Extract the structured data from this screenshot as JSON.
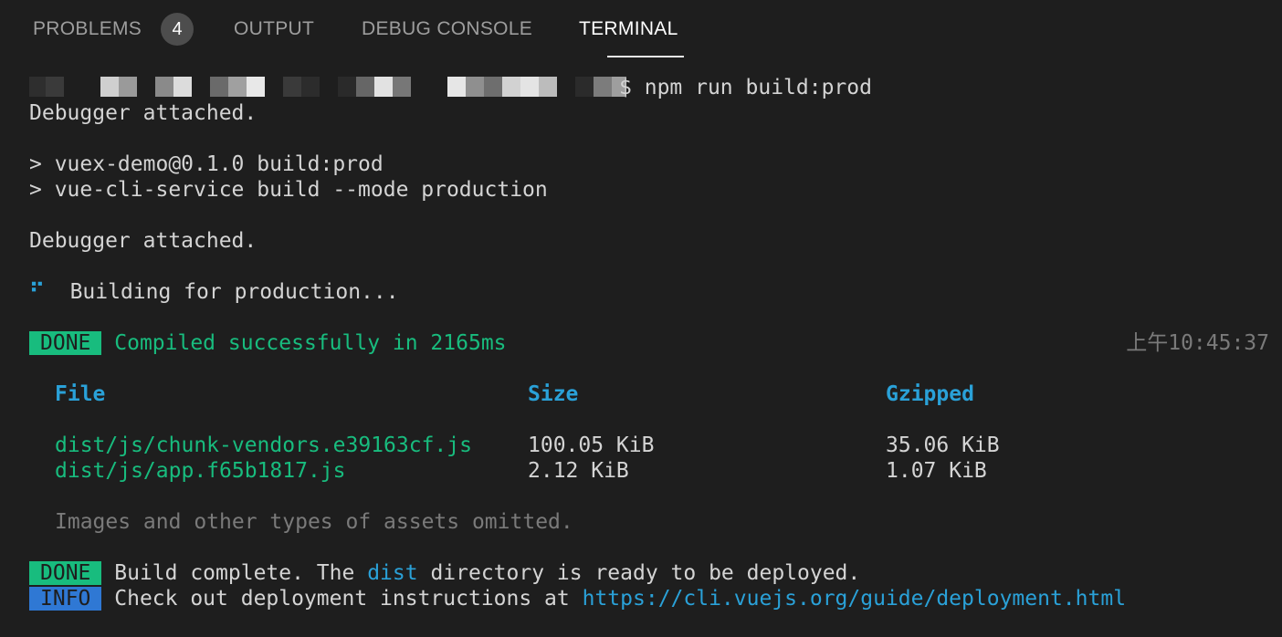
{
  "panel": {
    "tabs": [
      {
        "label": "PROBLEMS",
        "badge": "4"
      },
      {
        "label": "OUTPUT"
      },
      {
        "label": "DEBUG CONSOLE"
      },
      {
        "label": "TERMINAL",
        "active": true
      }
    ]
  },
  "terminal": {
    "prompt_symbol": "$",
    "command": "npm run build:prod",
    "debugger_1": "Debugger attached.",
    "script_1": "> vuex-demo@0.1.0 build:prod",
    "script_2": "> vue-cli-service build --mode production",
    "debugger_2": "Debugger attached.",
    "spinner": "⠋",
    "building": "Building for production...",
    "done_tag": "DONE",
    "compiled": "Compiled successfully in 2165ms",
    "timestamp": "上午10:45:37",
    "table": {
      "headers": [
        "File",
        "Size",
        "Gzipped"
      ],
      "rows": [
        {
          "file": "dist/js/chunk-vendors.e39163cf.js",
          "size": "100.05 KiB",
          "gzipped": "35.06 KiB"
        },
        {
          "file": "dist/js/app.f65b1817.js",
          "size": "2.12 KiB",
          "gzipped": "1.07 KiB"
        }
      ]
    },
    "omitted": "Images and other types of assets omitted.",
    "build_done_tag": "DONE",
    "build_complete_1": "Build complete. The ",
    "build_dist": "dist",
    "build_complete_2": " directory is ready to be deployed.",
    "info_tag": "INFO",
    "info_text": "Check out deployment instructions at ",
    "info_link": "https://cli.vuejs.org/guide/deployment.html"
  },
  "colors": {
    "background": "#1e1e1e",
    "success_green": "#18bc7e",
    "info_blue": "#2f78d4",
    "link_cyan": "#2aa1d8"
  }
}
